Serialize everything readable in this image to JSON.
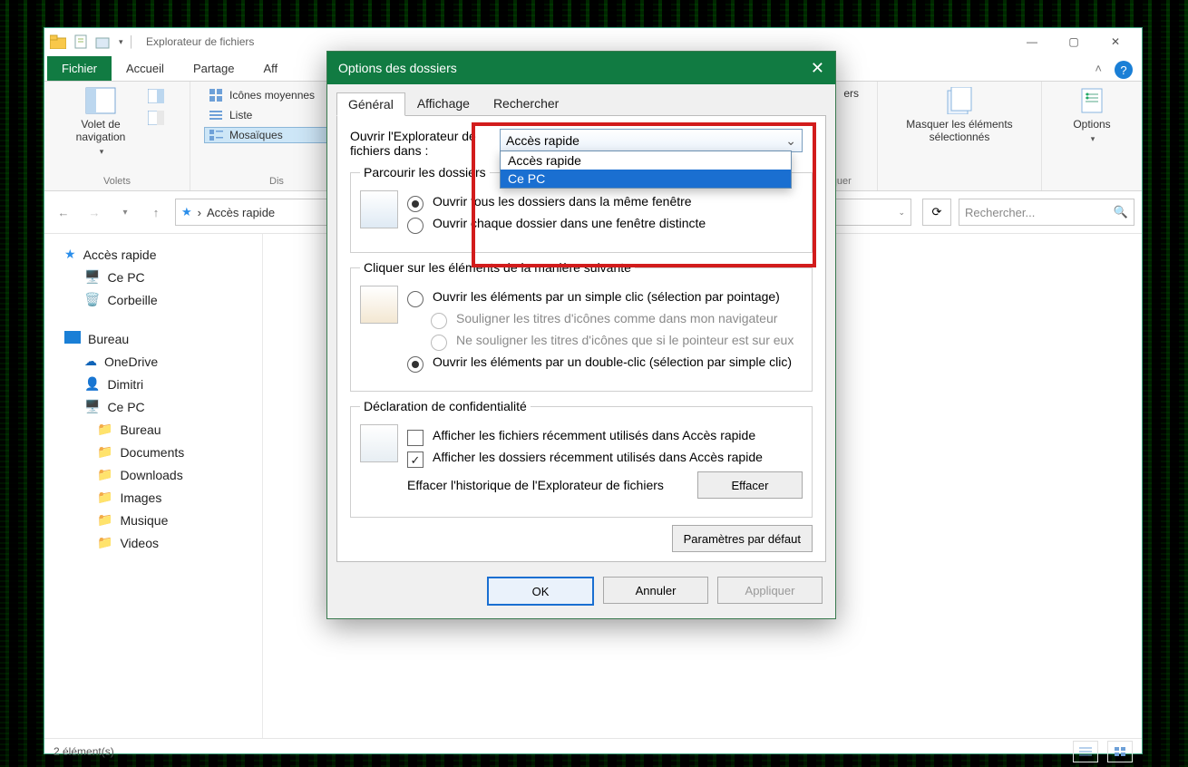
{
  "window": {
    "title": "Explorateur de fichiers",
    "tabs": {
      "file": "Fichier",
      "home": "Accueil",
      "share": "Partage",
      "view": "Aff"
    },
    "sysbuttons": {
      "min": "—",
      "max": "▢",
      "close": "✕"
    },
    "help": "?"
  },
  "ribbon": {
    "panes": {
      "label": "Volets",
      "navpane": "Volet de navigation",
      "prevcol": [
        "",
        ""
      ]
    },
    "layout": {
      "label": "Dis",
      "medium": "Icônes moyennes",
      "list": "Liste",
      "tiles": "Mosaïques"
    },
    "hide": {
      "big": "Masquer les éléments sélectionnés",
      "glabel": "asquer"
    },
    "options": {
      "big": "Options",
      "glabel": ""
    }
  },
  "nav": {
    "path_icon": "★",
    "path": "Accès rapide",
    "search_placeholder": "Rechercher..."
  },
  "sidebar": {
    "quick": "Accès rapide",
    "thispc": "Ce PC",
    "recycle": "Corbeille",
    "desktop": "Bureau",
    "onedrive": "OneDrive",
    "user": "Dimitri",
    "thispc2": "Ce PC",
    "children": {
      "bureau": "Bureau",
      "documents": "Documents",
      "downloads": "Downloads",
      "images": "Images",
      "music": "Musique",
      "videos": "Videos"
    }
  },
  "status": {
    "count": "2 élément(s)"
  },
  "dialog": {
    "title": "Options des dossiers",
    "tabs": {
      "general": "Général",
      "view": "Affichage",
      "search": "Rechercher"
    },
    "open_in_label": "Ouvrir l'Explorateur de fichiers dans :",
    "open_in_value": "Accès rapide",
    "open_in_options": {
      "o1": "Accès rapide",
      "o2": "Ce PC"
    },
    "browse_legend": "Parcourir les dossiers",
    "browse_same": "Ouvrir tous les dossiers dans la même fenêtre",
    "browse_sep": "Ouvrir chaque dossier dans une fenêtre distincte",
    "click_legend": "Cliquer sur les éléments de la manière suivante",
    "click_single": "Ouvrir les éléments par un simple clic (sélection par pointage)",
    "click_underline1": "Souligner les titres d'icônes comme dans mon navigateur",
    "click_underline2": "Ne souligner les titres d'icônes que si le pointeur est sur eux",
    "click_double": "Ouvrir les éléments par un double-clic (sélection par simple clic)",
    "privacy_legend": "Déclaration de confidentialité",
    "privacy_files": "Afficher les fichiers récemment utilisés dans Accès rapide",
    "privacy_folders": "Afficher les dossiers récemment utilisés dans Accès rapide",
    "privacy_clear_label": "Effacer l'historique de l'Explorateur de fichiers",
    "privacy_clear_btn": "Effacer",
    "defaults_btn": "Paramètres par défaut",
    "ok": "OK",
    "cancel": "Annuler",
    "apply": "Appliquer"
  }
}
